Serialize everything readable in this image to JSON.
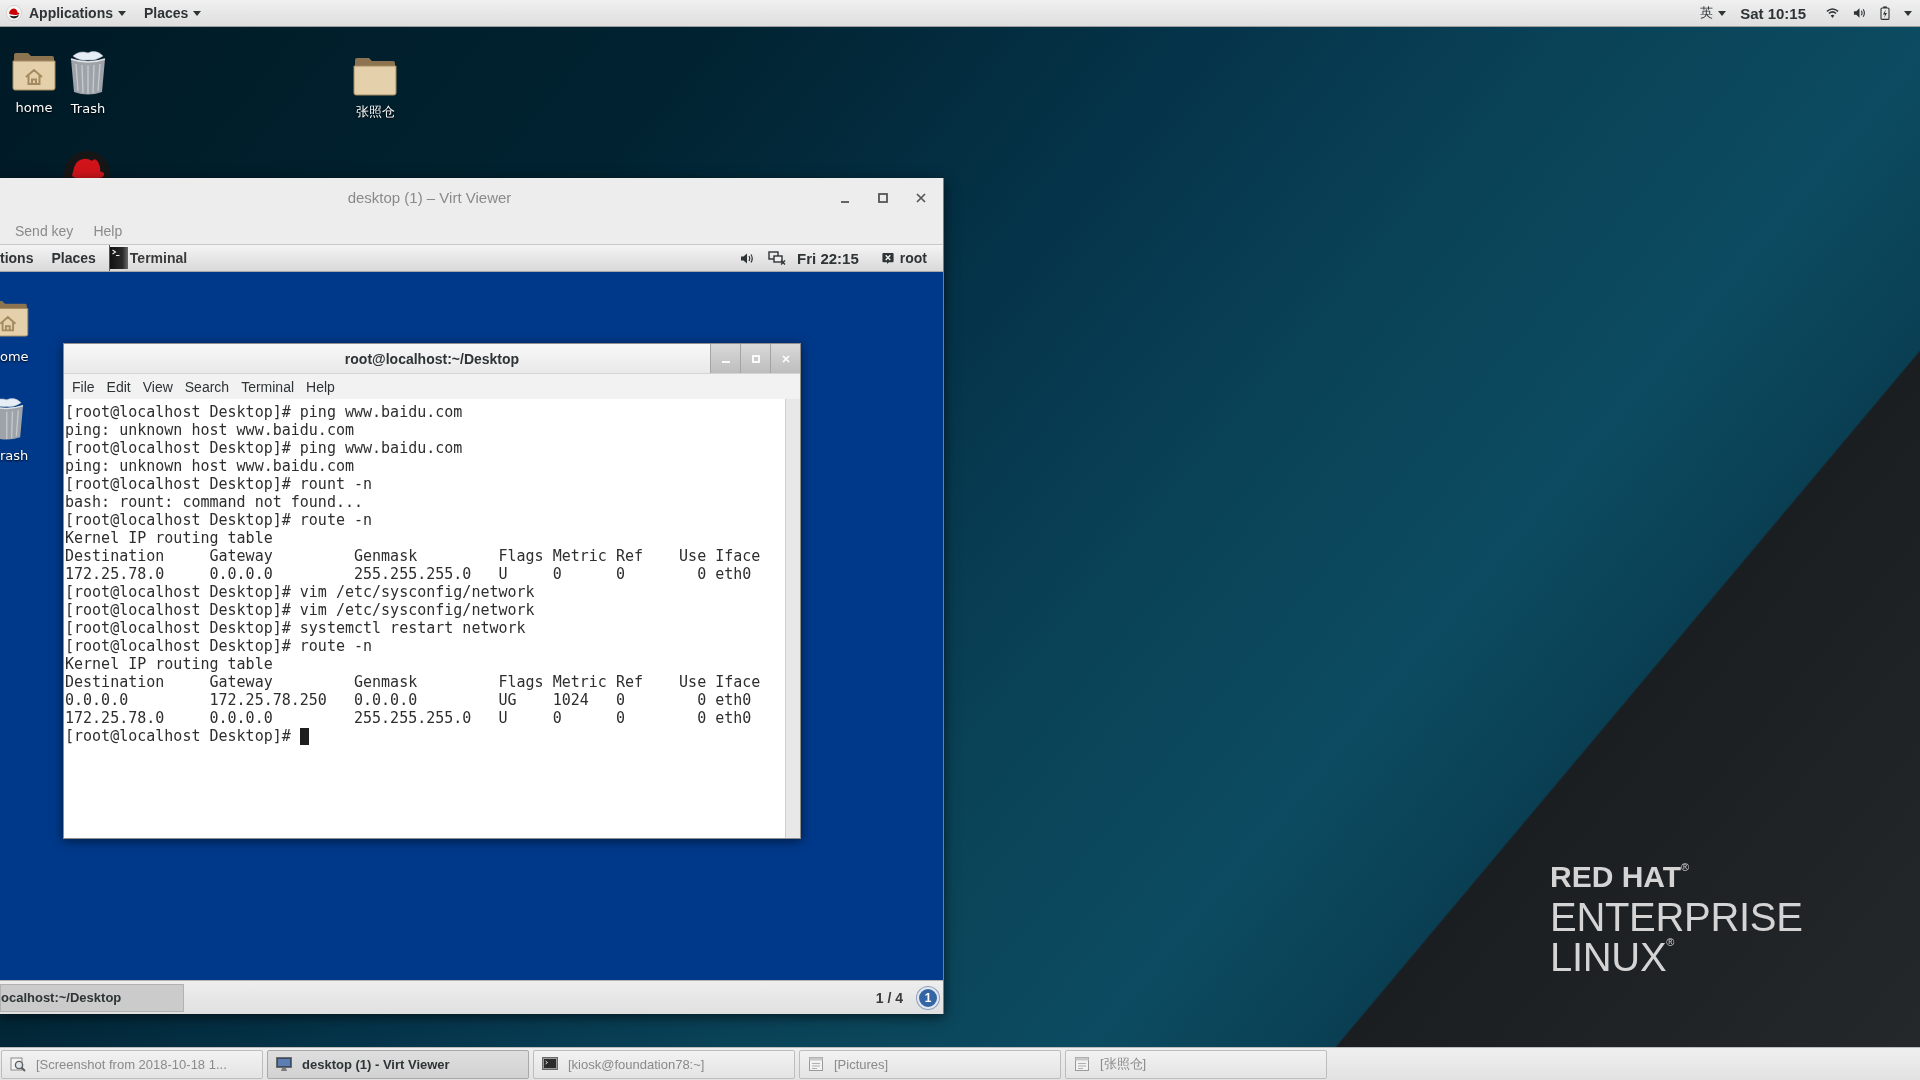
{
  "top_bar": {
    "menus": [
      "Applications",
      "Places"
    ],
    "input_method": "英",
    "clock": "Sat 10:15"
  },
  "desktop_icons": [
    {
      "kind": "home",
      "label": "home"
    },
    {
      "kind": "trash",
      "label": "Trash"
    },
    {
      "kind": "folder",
      "label": "张照仓"
    }
  ],
  "virt_viewer": {
    "title": "desktop (1) – Virt Viewer",
    "menu": [
      "Send key",
      "Help"
    ],
    "guest": {
      "top_bar": {
        "menus": [
          "tions",
          "Places"
        ],
        "task": "Terminal",
        "clock": "Fri 22:15",
        "user": "root"
      },
      "desktop_icons": [
        {
          "kind": "home",
          "label": "ome"
        },
        {
          "kind": "trash",
          "label": "rash"
        }
      ],
      "terminal": {
        "title": "root@localhost:~/Desktop",
        "menu": [
          "File",
          "Edit",
          "View",
          "Search",
          "Terminal",
          "Help"
        ],
        "lines": [
          "[root@localhost Desktop]# ping www.baidu.com",
          "ping: unknown host www.baidu.com",
          "[root@localhost Desktop]# ping www.baidu.com",
          "ping: unknown host www.baidu.com",
          "[root@localhost Desktop]# rount -n",
          "bash: rount: command not found...",
          "[root@localhost Desktop]# route -n",
          "Kernel IP routing table",
          "Destination     Gateway         Genmask         Flags Metric Ref    Use Iface",
          "172.25.78.0     0.0.0.0         255.255.255.0   U     0      0        0 eth0",
          "[root@localhost Desktop]# vim /etc/sysconfig/network",
          "[root@localhost Desktop]# vim /etc/sysconfig/network",
          "[root@localhost Desktop]# systemctl restart network",
          "[root@localhost Desktop]# route -n",
          "Kernel IP routing table",
          "Destination     Gateway         Genmask         Flags Metric Ref    Use Iface",
          "0.0.0.0         172.25.78.250   0.0.0.0         UG    1024   0        0 eth0",
          "172.25.78.0     0.0.0.0         255.255.255.0   U     0      0        0 eth0"
        ],
        "prompt": "[root@localhost Desktop]#",
        "cursor": true
      },
      "bottom_bar": {
        "task": "ocalhost:~/Desktop",
        "workspace": "1 / 4",
        "badge": "1"
      }
    }
  },
  "wallpaper": {
    "logo": [
      "RED HAT$^{®}$",
      "ENTERPRISE",
      "LINUX$^{®}$"
    ]
  },
  "taskbar": [
    {
      "kind": "screenshot",
      "label": "[Screenshot from 2018-10-18 1...",
      "selected": false
    },
    {
      "kind": "viewer",
      "label": "desktop (1) - Virt Viewer",
      "selected": true
    },
    {
      "kind": "terminal",
      "label": "[kiosk@foundation78:~]",
      "selected": false
    },
    {
      "kind": "files",
      "label": "[Pictures]",
      "selected": false
    },
    {
      "kind": "files",
      "label": "[张照仓]",
      "selected": false
    }
  ]
}
